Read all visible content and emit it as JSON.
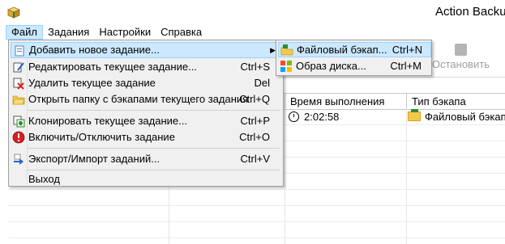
{
  "window": {
    "title": "Action Backu"
  },
  "menubar": {
    "items": [
      "Файл",
      "Задания",
      "Настройки",
      "Справка"
    ]
  },
  "toolbar": {
    "stop_label": "Остановить"
  },
  "table": {
    "columns": [
      "Время выполнения",
      "Тип бэкапа"
    ],
    "rows": [
      {
        "time": "2:02:58",
        "type": "Файловый бэкап"
      }
    ]
  },
  "file_menu": {
    "items": [
      {
        "label": "Добавить новое задание...",
        "shortcut": "",
        "icon": "add-task-icon",
        "submenu": true
      },
      {
        "label": "Редактировать текущее задание...",
        "shortcut": "Ctrl+S",
        "icon": "edit-icon"
      },
      {
        "label": "Удалить текущее задание",
        "shortcut": "Del",
        "icon": "delete-icon"
      },
      {
        "label": "Открыть папку с бэкапами текущего задания",
        "shortcut": "Ctrl+Q",
        "icon": "open-folder-icon"
      },
      {
        "label": "Клонировать текущее задание...",
        "shortcut": "Ctrl+P",
        "icon": "clone-icon"
      },
      {
        "label": "Включить/Отключить задание",
        "shortcut": "Ctrl+O",
        "icon": "toggle-icon"
      },
      {
        "label": "Экспорт/Импорт заданий...",
        "shortcut": "Ctrl+V",
        "icon": "export-import-icon"
      },
      {
        "label": "Выход",
        "shortcut": "",
        "icon": ""
      }
    ]
  },
  "submenu": {
    "items": [
      {
        "label": "Файловый бэкап...",
        "shortcut": "Ctrl+N",
        "icon": "file-backup-icon"
      },
      {
        "label": "Образ диска...",
        "shortcut": "Ctrl+M",
        "icon": "disk-image-icon"
      }
    ]
  },
  "colors": {
    "highlight": "#cce8ff",
    "highlight_border": "#99d1ff",
    "menu_bg": "#f0f0f0"
  }
}
